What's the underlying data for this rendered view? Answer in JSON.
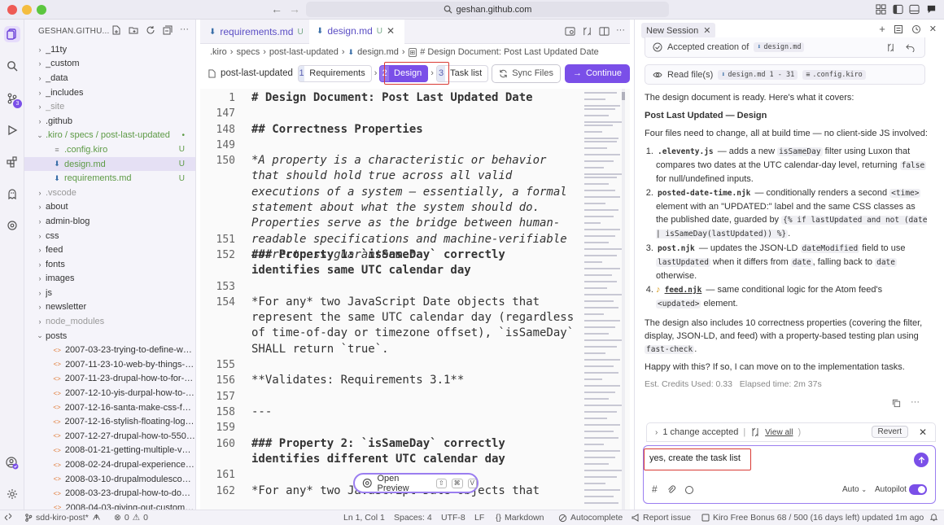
{
  "window": {
    "address": "geshan.github.com"
  },
  "explorer": {
    "title": "GESHAN.GITHU...",
    "items": [
      {
        "name": "_11ty",
        "type": "folder",
        "depth": 0,
        "open": false,
        "badge": ""
      },
      {
        "name": "_custom",
        "type": "folder",
        "depth": 0,
        "open": false,
        "badge": ""
      },
      {
        "name": "_data",
        "type": "folder",
        "depth": 0,
        "open": false,
        "badge": ""
      },
      {
        "name": "_includes",
        "type": "folder",
        "depth": 0,
        "open": false,
        "badge": ""
      },
      {
        "name": "_site",
        "type": "folder",
        "depth": 0,
        "open": false,
        "badge": "",
        "dim": true
      },
      {
        "name": ".github",
        "type": "folder",
        "depth": 0,
        "open": false,
        "badge": ""
      },
      {
        "name": ".kiro / specs / post-last-updated",
        "type": "folder",
        "depth": 0,
        "open": true,
        "badge": "•",
        "green": true
      },
      {
        "name": ".config.kiro",
        "type": "config",
        "depth": 1,
        "open": false,
        "badge": "U",
        "green": true
      },
      {
        "name": "design.md",
        "type": "md",
        "depth": 1,
        "open": false,
        "badge": "U",
        "green": true,
        "selected": true
      },
      {
        "name": "requirements.md",
        "type": "md",
        "depth": 1,
        "open": false,
        "badge": "U",
        "green": true
      },
      {
        "name": ".vscode",
        "type": "folder",
        "depth": 0,
        "open": false,
        "badge": "",
        "dim": true
      },
      {
        "name": "about",
        "type": "folder",
        "depth": 0,
        "open": false,
        "badge": ""
      },
      {
        "name": "admin-blog",
        "type": "folder",
        "depth": 0,
        "open": false,
        "badge": ""
      },
      {
        "name": "css",
        "type": "folder",
        "depth": 0,
        "open": false,
        "badge": ""
      },
      {
        "name": "feed",
        "type": "folder",
        "depth": 0,
        "open": false,
        "badge": ""
      },
      {
        "name": "fonts",
        "type": "folder",
        "depth": 0,
        "open": false,
        "badge": ""
      },
      {
        "name": "images",
        "type": "folder",
        "depth": 0,
        "open": false,
        "badge": ""
      },
      {
        "name": "js",
        "type": "folder",
        "depth": 0,
        "open": false,
        "badge": ""
      },
      {
        "name": "newsletter",
        "type": "folder",
        "depth": 0,
        "open": false,
        "badge": ""
      },
      {
        "name": "node_modules",
        "type": "folder",
        "depth": 0,
        "open": false,
        "badge": "",
        "dim": true
      },
      {
        "name": "posts",
        "type": "folder",
        "depth": 0,
        "open": true,
        "badge": ""
      },
      {
        "name": "2007-03-23-trying-to-define-web...",
        "type": "html",
        "depth": 1,
        "open": false,
        "badge": ""
      },
      {
        "name": "2007-11-23-10-web-by-things-te...",
        "type": "html",
        "depth": 1,
        "open": false,
        "badge": ""
      },
      {
        "name": "2007-11-23-drupal-how-to-for-be...",
        "type": "html",
        "depth": 1,
        "open": false,
        "badge": ""
      },
      {
        "name": "2007-12-10-yis-durpal-how-to-m...",
        "type": "html",
        "depth": 1,
        "open": false,
        "badge": ""
      },
      {
        "name": "2007-12-16-santa-make-css-fully...",
        "type": "html",
        "depth": 1,
        "open": false,
        "badge": ""
      },
      {
        "name": "2007-12-16-stylish-floating-login-...",
        "type": "html",
        "depth": 1,
        "open": false,
        "badge": ""
      },
      {
        "name": "2007-12-27-drupal-how-to-550-d...",
        "type": "html",
        "depth": 1,
        "open": false,
        "badge": ""
      },
      {
        "name": "2008-01-21-getting-multiple-valu...",
        "type": "html",
        "depth": 1,
        "open": false,
        "badge": ""
      },
      {
        "name": "2008-02-24-drupal-experience-s...",
        "type": "html",
        "depth": 1,
        "open": false,
        "badge": ""
      },
      {
        "name": "2008-03-10-drupalmodulescom-...",
        "type": "html",
        "depth": 1,
        "open": false,
        "badge": ""
      },
      {
        "name": "2008-03-23-drupal-how-to-down...",
        "type": "html",
        "depth": 1,
        "open": false,
        "badge": ""
      },
      {
        "name": "2008-04-03-giving-out-custom-r...",
        "type": "html",
        "depth": 1,
        "open": false,
        "badge": ""
      }
    ]
  },
  "editor": {
    "tabs": [
      {
        "label": "requirements.md",
        "status": "U",
        "active": false
      },
      {
        "label": "design.md",
        "status": "U",
        "active": true
      }
    ],
    "breadcrumb": [
      ".kiro",
      "specs",
      "post-last-updated",
      "design.md",
      "# Design Document: Post Last Updated Date"
    ],
    "spec_name": "post-last-updated",
    "steps": [
      {
        "num": "1",
        "label": "Requirements",
        "active": false
      },
      {
        "num": "2",
        "label": "Design",
        "active": true
      },
      {
        "num": "3",
        "label": "Task list",
        "active": false
      }
    ],
    "sync_label": "Sync Files",
    "continue_label": "Continue",
    "open_preview_label": "Open Preview",
    "preview_keys": [
      "⇧",
      "⌘",
      "V"
    ],
    "lines": [
      {
        "n": "1",
        "text": "# Design Document: Post Last Updated Date",
        "style": "h1"
      },
      {
        "n": "147",
        "text": "",
        "style": "plain"
      },
      {
        "n": "148",
        "text": "## Correctness Properties",
        "style": "h2"
      },
      {
        "n": "149",
        "text": "",
        "style": "plain"
      },
      {
        "n": "150",
        "text": "*A property is a characteristic or behavior that should hold true across all valid executions of a system — essentially, a formal statement about what the system should do. Properties serve as the bridge between human-readable specifications and machine-verifiable correctness guarantees.*",
        "style": "italic",
        "rows": 5
      },
      {
        "n": "151",
        "text": "",
        "style": "plain"
      },
      {
        "n": "152",
        "text": "### Property 1: `isSameDay` correctly identifies same UTC calendar day",
        "style": "h3",
        "rows": 2
      },
      {
        "n": "153",
        "text": "",
        "style": "plain"
      },
      {
        "n": "154",
        "text": "*For any* two JavaScript Date objects that represent the same UTC calendar day (regardless of time-of-day or timezone offset), `isSameDay` SHALL return `true`.",
        "style": "mixed",
        "rows": 4
      },
      {
        "n": "155",
        "text": "",
        "style": "plain"
      },
      {
        "n": "156",
        "text": "**Validates: Requirements 3.1**",
        "style": "bold"
      },
      {
        "n": "157",
        "text": "",
        "style": "plain"
      },
      {
        "n": "158",
        "text": "---",
        "style": "plain"
      },
      {
        "n": "159",
        "text": "",
        "style": "plain"
      },
      {
        "n": "160",
        "text": "### Property 2: `isSameDay` correctly identifies different UTC calendar day",
        "style": "h3",
        "rows": 2
      },
      {
        "n": "161",
        "text": "",
        "style": "plain"
      },
      {
        "n": "162",
        "text": "*For any* two JavaScript Date objects that",
        "style": "mixed"
      }
    ]
  },
  "chat": {
    "session_tab": "New Session",
    "accepted_creation": "Accepted creation of",
    "accepted_file": "design.md",
    "read_files_label": "Read file(s)",
    "read_file_1": "design.md 1 - 31",
    "read_file_2": ".config.kiro",
    "intro": "The design document is ready. Here's what it covers:",
    "heading": "Post Last Updated — Design",
    "lead": "Four files need to change, all at build time — no client-side JS involved:",
    "items": [
      {
        "file": ".eleventy.js",
        "pre": " — adds a new ",
        "c1": "isSameDay",
        "mid": " filter using Luxon that compares two dates at the UTC calendar-day level, returning ",
        "c2": "false",
        "post": " for null/undefined inputs."
      },
      {
        "file": "posted-date-time.njk",
        "pre": " — conditionally renders a second ",
        "c1": "<time>",
        "mid": " element with an \"UPDATED:\" label and the same CSS classes as the published date, guarded by ",
        "c2": "{% if lastUpdated and not (date | isSameDay(lastUpdated)) %}",
        "post": "."
      },
      {
        "file": "post.njk",
        "pre": " — updates the JSON-LD ",
        "c1": "dateModified",
        "mid": " field to use ",
        "c2": "lastUpdated",
        "post": " when it differs from ",
        "c3": "date",
        "post2": ", falling back to ",
        "c4": "date",
        "post3": " otherwise."
      },
      {
        "file": "feed.njk",
        "pre": " — same conditional logic for the Atom feed's ",
        "c1": "<updated>",
        "mid": " element.",
        "c2": "",
        "post": ""
      }
    ],
    "summary_pre": "The design also includes 10 correctness properties (covering the filter, display, JSON-LD, and feed) with a property-based testing plan using ",
    "summary_code": "fast-check",
    "summary_post": ".",
    "question": "Happy with this? If so, I can move on to the implementation tasks.",
    "credits": "Est. Credits Used: 0.33",
    "elapsed": "Elapsed time: 2m 37s",
    "change_accepted": "1 change accepted",
    "view_all": "View all",
    "revert": "Revert",
    "input_value": "yes, create the task list",
    "mode": "Auto",
    "autopilot": "Autopilot"
  },
  "statusbar": {
    "branch": "sdd-kiro-post*",
    "problems": "0",
    "warnings": "0",
    "position": "Ln 1, Col 1",
    "spaces": "Spaces: 4",
    "encoding": "UTF-8",
    "eol": "LF",
    "language": "Markdown",
    "autocomplete": "Autocomplete",
    "report": "Report issue",
    "plan": "Kiro Free Bonus 68 / 500 (16 days left) updated 1m ago"
  },
  "colors": {
    "accent": "#7a4fe8",
    "highlight_box": "#d93a34",
    "modified_badge": "#5d9a45"
  }
}
